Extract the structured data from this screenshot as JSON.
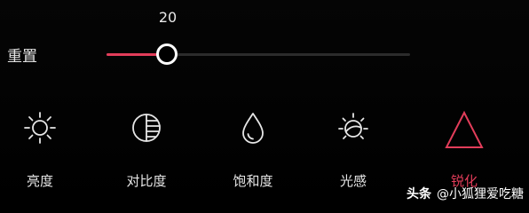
{
  "slider": {
    "value_label": "20",
    "fill_fraction": 0.2
  },
  "reset_button": {
    "label": "重置"
  },
  "tools": [
    {
      "label": "亮度",
      "icon": "sun-icon",
      "active": false
    },
    {
      "label": "对比度",
      "icon": "contrast-icon",
      "active": false
    },
    {
      "label": "饱和度",
      "icon": "droplet-icon",
      "active": false
    },
    {
      "label": "光感",
      "icon": "light-sense-icon",
      "active": false
    },
    {
      "label": "锐化",
      "icon": "triangle-icon",
      "active": true
    }
  ],
  "colors": {
    "accent": "#e23d5a",
    "background": "#000000",
    "track": "#2c2c2c",
    "text": "#e6e6e6"
  },
  "watermark": {
    "brand": "头条",
    "handle": "@小狐狸爱吃糖"
  }
}
